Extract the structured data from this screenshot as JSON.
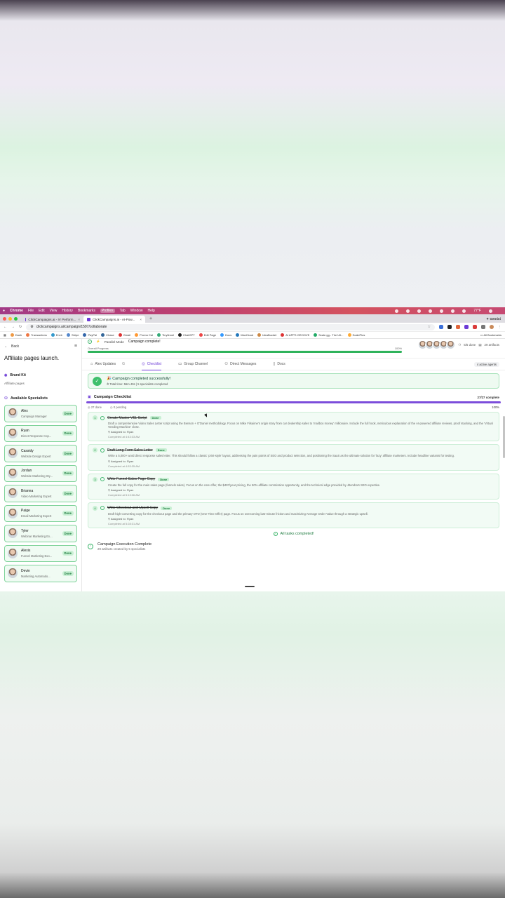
{
  "menubar": {
    "items": [
      "Chrome",
      "File",
      "Edit",
      "View",
      "History",
      "Bookmarks",
      "Profiles",
      "Tab",
      "Window",
      "Help"
    ],
    "highlighted": "Profiles",
    "clock": "77°F"
  },
  "browser": {
    "tabs": [
      {
        "title": "ClickCampaigns.ai - IV Perform..."
      },
      {
        "title": "ClickCampaigns.ai - AI-Pow..."
      }
    ],
    "gemini": "✦ Gemini",
    "url": "clickcampaigns.ai/campaign/1597/collaborate",
    "bookmarks": [
      "Dash",
      "Transactions",
      "Envir",
      "Stripe",
      "PayPal",
      "Chase",
      "Gmail",
      "Promo Cal",
      "Tinyfinnel",
      "ChatGPT",
      "Edit Page",
      "Docs",
      "MaxCloud",
      "IdeaBucket",
      "AI APPS GROOVE",
      "Scale.gg - The Ult...",
      "ScalePlus"
    ],
    "all_bookmarks": "All Bookmarks"
  },
  "sidebar": {
    "back": "Back",
    "project_title": "Affiliate pages launch.",
    "brand_kit": "Brand Kit",
    "brand_kit_sub": "Affiliate pages",
    "specialists_header": "Available Specialists",
    "specialists": [
      {
        "name": "Alex",
        "role": "Campaign Manager",
        "status": "Done"
      },
      {
        "name": "Ryan",
        "role": "Direct Response Cop...",
        "status": "Done"
      },
      {
        "name": "Cassidy",
        "role": "Website Design Expert",
        "status": "Done"
      },
      {
        "name": "Jordan",
        "role": "Website Marketing Sty...",
        "status": "Done"
      },
      {
        "name": "Brianna",
        "role": "Video Marketing Expert",
        "status": "Done"
      },
      {
        "name": "Paige",
        "role": "Email Marketing Expert",
        "status": "Done"
      },
      {
        "name": "Tyler",
        "role": "Webinar Marketing Ex...",
        "status": "Done"
      },
      {
        "name": "Alexis",
        "role": "Funnel Marketing Exo...",
        "status": "Done"
      },
      {
        "name": "Devin",
        "role": "Marketing Automatio...",
        "status": "Done"
      }
    ]
  },
  "topstrip": {
    "mode": "Parallel Mode",
    "status": "Campaign complete!",
    "overall_label": "Overall Progress",
    "overall_pct": "100%",
    "overall_value": 1.0,
    "done_count": "5/5 done",
    "artifacts": "29 artifacts"
  },
  "navtabs": [
    {
      "label": "Alex Updates",
      "icon": "⌂",
      "extra": "G"
    },
    {
      "label": "Checklist",
      "icon": "◎",
      "active": true
    },
    {
      "label": "Group Channel",
      "icon": "▭"
    },
    {
      "label": "Direct Messages",
      "icon": "⚇"
    },
    {
      "label": "Docs",
      "icon": "▯"
    }
  ],
  "active_agents": "4 active agents",
  "success": {
    "title": "🎉 Campaign completed successfully!",
    "sub": "⏱ Total time: 56m 49s  |  5 specialists completed"
  },
  "checklist": {
    "title": "Campaign Checklist",
    "count": "27/27 complete",
    "done": "27 done",
    "pending": "0 pending",
    "pct": "100%",
    "tasks": [
      {
        "num": "1",
        "title": "Create Master VSL Script",
        "status": "Done",
        "desc": "Draft a comprehensive Video Sales Letter script using the Benson + O'Daniel methodology. Focus on Mike Filsaime's origin story from car dealership sales to 'mailbox money' millionaire. Include the full hook, meticulous explanation of the AI-powered affiliate reviews, proof stacking, and the 'Virtual Vending Machine' close.",
        "assigned": "Assigned to: Ryan",
        "completed": "Completed at 4:43:33 AM"
      },
      {
        "num": "2",
        "title": "Draft Long-Form Sales Letter",
        "status": "Done",
        "desc": "Write a 5,000+ word direct response sales letter. This should follow a classic 'print-style' layout, addressing the pain points of SEO and product selection, and positioning the SaaS as the ultimate solution for 'lazy' affiliate marketers. Include headline variants for testing.",
        "assigned": "Assigned to: Ryan",
        "completed": "Completed at 4:53:35 AM"
      },
      {
        "num": "3",
        "title": "Write Funnel Sales Page Copy",
        "status": "Done",
        "desc": "Create the full copy for the main sales page (funnels sales). Focus on the core offer, the $497/year pricing, the 50% affiliate commission opportunity, and the technical edge provided by Jitendra's SEO expertise.",
        "assigned": "Assigned to: Ryan",
        "completed": "Completed at 5:13:06 AM"
      },
      {
        "num": "4",
        "title": "Write Checkout and Upsell Copy",
        "status": "Done",
        "desc": "Draft high-converting copy for the checkout page and the primary OTO (One-Time Offer) page. Focus on overcoming last-minute friction and maximizing Average Order Value through a strategic upsell.",
        "assigned": "Assigned to: Ryan",
        "completed": "Completed at 5:28:31 AM"
      }
    ],
    "all_done": "All tasks completed!"
  },
  "execution": {
    "title": "Campaign Execution Complete",
    "sub": "29 artifacts created by 5 specialists"
  }
}
